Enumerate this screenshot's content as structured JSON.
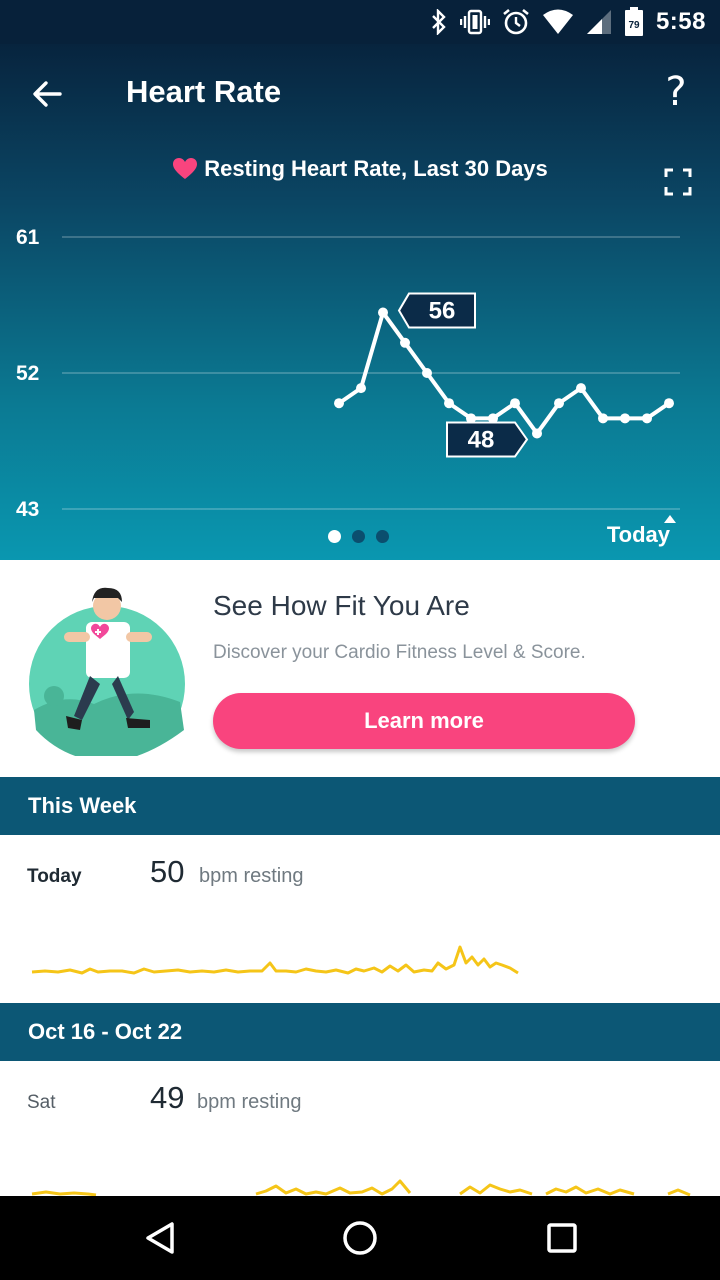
{
  "status_bar": {
    "time": "5:58",
    "battery": "79"
  },
  "app_bar": {
    "title": "Heart Rate",
    "help": "?"
  },
  "chart_heading": "Resting Heart Rate, Last 30 Days",
  "chart_data": {
    "type": "line",
    "title": "Resting Heart Rate, Last 30 Days",
    "y_ticks": [
      "61",
      "52",
      "43"
    ],
    "ylim": [
      43,
      61
    ],
    "y_values": [
      50,
      51,
      56,
      54,
      52,
      50,
      49,
      49,
      50,
      48,
      50,
      51,
      49,
      49,
      49,
      50
    ],
    "callouts": [
      {
        "label": "56"
      },
      {
        "label": "48"
      }
    ],
    "line_color": "#ffffff",
    "grid": true,
    "x_end_label": "Today"
  },
  "pager": {
    "count": 3,
    "active": 0
  },
  "today_label": "Today",
  "promo": {
    "title": "See How Fit You Are",
    "subtitle": "Discover your Cardio Fitness Level & Score.",
    "button": "Learn more"
  },
  "sections": [
    {
      "header": "This Week",
      "day": "Today",
      "value": "50",
      "unit": "bpm resting"
    },
    {
      "header": "Oct 16 - Oct 22",
      "day": "Sat",
      "value": "49",
      "unit": "bpm resting"
    }
  ],
  "colors": {
    "accent": "#f9447e",
    "section_bg": "#0c5775",
    "spark": "#f5c518"
  },
  "nav": {
    "back": "back-icon",
    "home": "home-icon",
    "recents": "recents-icon"
  }
}
